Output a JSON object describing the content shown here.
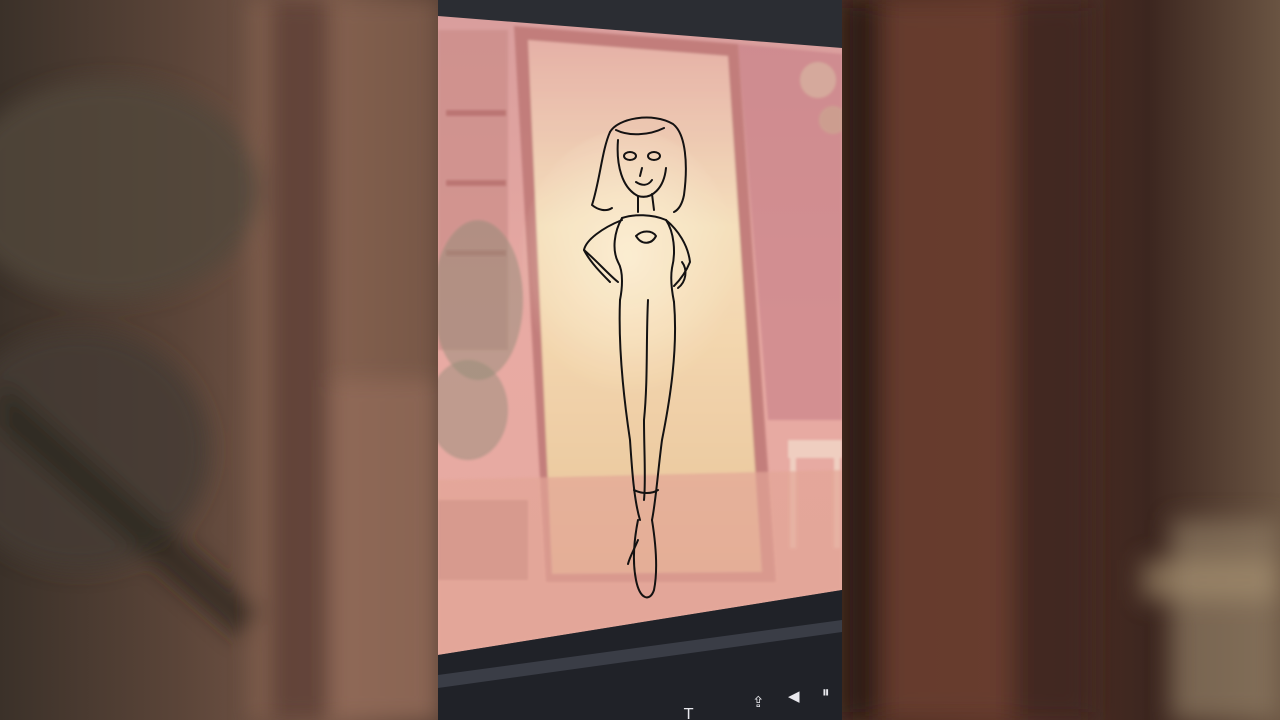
{
  "scene": {
    "subject": "tablet-screen-with-character-sketch",
    "accent_colors": {
      "screen_bg": "#e7a9a4",
      "mirror_glow": "#f6e3b8",
      "sketch_line": "#111111",
      "bezel": "#24262c"
    }
  },
  "toolbar": {
    "icons": [
      {
        "name": "text-tool-icon",
        "glyph": "T"
      },
      {
        "name": "export-icon",
        "glyph": "⇪"
      },
      {
        "name": "previous-frame-icon",
        "glyph": "◀"
      },
      {
        "name": "pause-icon",
        "glyph": "⏸"
      }
    ]
  }
}
